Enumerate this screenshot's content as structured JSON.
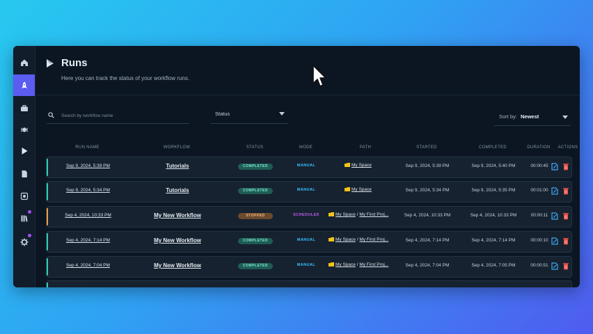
{
  "sidebar": {
    "items": [
      {
        "name": "home",
        "icon": "home-icon"
      },
      {
        "name": "assistant",
        "icon": "rocket-icon",
        "active": true
      },
      {
        "name": "tools",
        "icon": "toolbox-icon"
      },
      {
        "name": "components",
        "icon": "bug-icon"
      },
      {
        "name": "runs",
        "icon": "play-icon"
      },
      {
        "name": "files",
        "icon": "document-icon"
      },
      {
        "name": "storage",
        "icon": "database-icon"
      },
      {
        "name": "library",
        "icon": "library-icon",
        "badge": true
      },
      {
        "name": "settings",
        "icon": "gear-icon",
        "badge": true
      }
    ]
  },
  "header": {
    "title": "Runs",
    "subtitle": "Here you can track the status of your workflow runs."
  },
  "filters": {
    "search_placeholder": "Search by workflow name",
    "status_label": "Status",
    "sort_label": "Sort by:",
    "sort_value": "Newest"
  },
  "table": {
    "columns": [
      "RUN NAME",
      "WORKFLOW",
      "STATUS",
      "MODE",
      "PATH",
      "STARTED",
      "COMPLETED",
      "DURATION",
      "ACTIONS"
    ],
    "rows": [
      {
        "run_name": "Sep 9, 2024, 5:39 PM",
        "workflow": "Tutorials",
        "status": "COMPLETED",
        "status_key": "completed",
        "mode": "MANUAL",
        "mode_key": "manual",
        "path": [
          "My Space"
        ],
        "started": "Sep 9, 2024, 5:39 PM",
        "completed": "Sep 9, 2024, 5:40 PM",
        "duration": "00:00:45",
        "accent": "#2fd1b4"
      },
      {
        "run_name": "Sep 9, 2024, 5:34 PM",
        "workflow": "Tutorials",
        "status": "COMPLETED",
        "status_key": "completed",
        "mode": "MANUAL",
        "mode_key": "manual",
        "path": [
          "My Space"
        ],
        "started": "Sep 9, 2024, 5:34 PM",
        "completed": "Sep 9, 2024, 5:35 PM",
        "duration": "00:01:00",
        "accent": "#2fd1b4"
      },
      {
        "run_name": "Sep 4, 2024, 10:33 PM",
        "workflow": "My New Workflow",
        "status": "STOPPED",
        "status_key": "stopped",
        "mode": "SCHEDULED",
        "mode_key": "scheduled",
        "path": [
          "My Space",
          "My First Proj..."
        ],
        "started": "Sep 4, 2024, 10:33 PM",
        "completed": "Sep 4, 2024, 10:33 PM",
        "duration": "00:00:11",
        "accent": "#f0a040"
      },
      {
        "run_name": "Sep 4, 2024, 7:14 PM",
        "workflow": "My New Workflow",
        "status": "COMPLETED",
        "status_key": "completed",
        "mode": "MANUAL",
        "mode_key": "manual",
        "path": [
          "My Space",
          "My First Proj..."
        ],
        "started": "Sep 4, 2024, 7:14 PM",
        "completed": "Sep 4, 2024, 7:14 PM",
        "duration": "00:00:10",
        "accent": "#2fd1b4"
      },
      {
        "run_name": "Sep 4, 2024, 7:04 PM",
        "workflow": "My New Workflow",
        "status": "COMPLETED",
        "status_key": "completed",
        "mode": "MANUAL",
        "mode_key": "manual",
        "path": [
          "My Space",
          "My First Proj..."
        ],
        "started": "Sep 4, 2024, 7:04 PM",
        "completed": "Sep 4, 2024, 7:05 PM",
        "duration": "00:00:51",
        "accent": "#2fd1b4"
      }
    ]
  },
  "colors": {
    "manual": "#39c2ff",
    "scheduled": "#c15cf0",
    "accent": "#5b5cf0",
    "edit_icon": "#3fa9f5",
    "delete_icon": "#e0504a",
    "folder_icon": "#f2c318"
  },
  "path_separator": " / "
}
